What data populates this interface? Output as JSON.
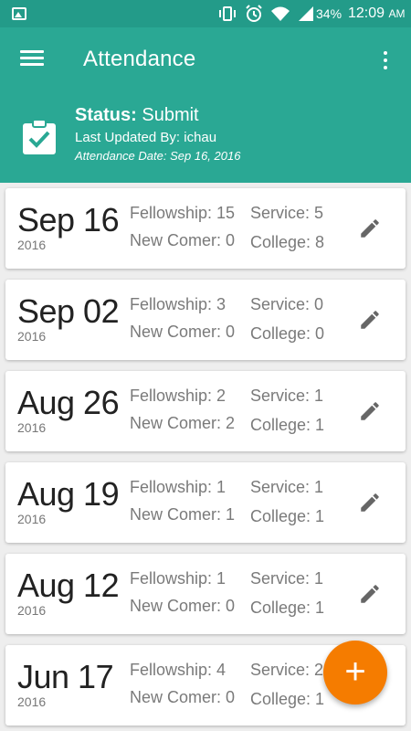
{
  "status_bar": {
    "battery_percent": "34%",
    "time": "12:09",
    "ampm": "AM",
    "icons": [
      "image-icon",
      "vibrate-icon",
      "alarm-icon",
      "wifi-icon",
      "signal-icon",
      "battery-icon"
    ]
  },
  "app_bar": {
    "title": "Attendance",
    "menu_icon": "hamburger-menu-icon",
    "overflow_icon": "more-vert-icon"
  },
  "summary": {
    "icon": "clipboard-check-icon",
    "status_label": "Status:",
    "status_value": "Submit",
    "updated_label": "Last Updated By:",
    "updated_value": "ichau",
    "date_label": "Attendance Date:",
    "date_value": "Sep 16, 2016"
  },
  "records": [
    {
      "date": "Sep 16",
      "year": "2016",
      "fellowship": "Fellowship: 15",
      "new_comer": "New Comer: 0",
      "service": "Service: 5",
      "college": "College: 8"
    },
    {
      "date": "Sep 02",
      "year": "2016",
      "fellowship": "Fellowship: 3",
      "new_comer": "New Comer: 0",
      "service": "Service: 0",
      "college": "College: 0"
    },
    {
      "date": "Aug 26",
      "year": "2016",
      "fellowship": "Fellowship: 2",
      "new_comer": "New Comer: 2",
      "service": "Service: 1",
      "college": "College: 1"
    },
    {
      "date": "Aug 19",
      "year": "2016",
      "fellowship": "Fellowship: 1",
      "new_comer": "New Comer: 1",
      "service": "Service: 1",
      "college": "College: 1"
    },
    {
      "date": "Aug 12",
      "year": "2016",
      "fellowship": "Fellowship: 1",
      "new_comer": "New Comer: 0",
      "service": "Service: 1",
      "college": "College: 1"
    },
    {
      "date": "Jun 17",
      "year": "2016",
      "fellowship": "Fellowship: 4",
      "new_comer": "New Comer: 0",
      "service": "Service: 2",
      "college": "College: 1"
    }
  ],
  "fab": {
    "label": "+",
    "icon": "add-icon"
  },
  "colors": {
    "primary": "#2aa894",
    "primary_dark": "#239b89",
    "accent": "#f57c00",
    "background": "#eeeeee"
  }
}
